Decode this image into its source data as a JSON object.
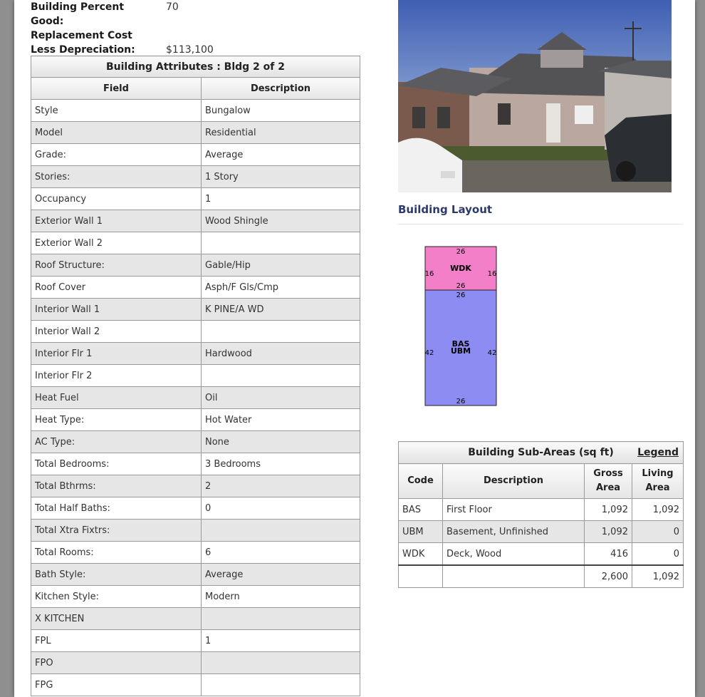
{
  "summary": {
    "rows": [
      {
        "label": "Building Percent",
        "value": "70"
      },
      {
        "label": "Good:",
        "value": ""
      },
      {
        "label": "Replacement Cost",
        "value": ""
      },
      {
        "label": "Less Depreciation:",
        "value": "$113,100"
      }
    ]
  },
  "attributes": {
    "caption": "Building Attributes : Bldg 2 of 2",
    "headers": {
      "field": "Field",
      "description": "Description"
    },
    "rows": [
      {
        "field": "Style",
        "description": "Bungalow"
      },
      {
        "field": "Model",
        "description": "Residential"
      },
      {
        "field": "Grade:",
        "description": "Average"
      },
      {
        "field": "Stories:",
        "description": "1 Story"
      },
      {
        "field": "Occupancy",
        "description": "1"
      },
      {
        "field": "Exterior Wall 1",
        "description": "Wood Shingle"
      },
      {
        "field": "Exterior Wall 2",
        "description": ""
      },
      {
        "field": "Roof Structure:",
        "description": "Gable/Hip"
      },
      {
        "field": "Roof Cover",
        "description": "Asph/F Gls/Cmp"
      },
      {
        "field": "Interior Wall 1",
        "description": "K PINE/A WD"
      },
      {
        "field": "Interior Wall 2",
        "description": ""
      },
      {
        "field": "Interior Flr 1",
        "description": "Hardwood"
      },
      {
        "field": "Interior Flr 2",
        "description": ""
      },
      {
        "field": "Heat Fuel",
        "description": "Oil"
      },
      {
        "field": "Heat Type:",
        "description": "Hot Water"
      },
      {
        "field": "AC Type:",
        "description": "None"
      },
      {
        "field": "Total Bedrooms:",
        "description": "3 Bedrooms"
      },
      {
        "field": "Total Bthrms:",
        "description": "2"
      },
      {
        "field": "Total Half Baths:",
        "description": "0"
      },
      {
        "field": "Total Xtra Fixtrs:",
        "description": ""
      },
      {
        "field": "Total Rooms:",
        "description": "6"
      },
      {
        "field": "Bath Style:",
        "description": "Average"
      },
      {
        "field": "Kitchen Style:",
        "description": "Modern"
      },
      {
        "field": "X KITCHEN",
        "description": ""
      },
      {
        "field": "FPL",
        "description": "1"
      },
      {
        "field": "FPO",
        "description": ""
      },
      {
        "field": "FPG",
        "description": ""
      }
    ]
  },
  "layout": {
    "title": "Building Layout",
    "sketch": {
      "top_section": {
        "label": "WDK",
        "top": "26",
        "bottom": "26",
        "left": "16",
        "right": "16",
        "color": "#f27fc8"
      },
      "bottom_section": {
        "label1": "BAS",
        "label2": "UBM",
        "top": "26",
        "bottom": "26",
        "left": "42",
        "right": "42",
        "color": "#8c8cf2"
      }
    }
  },
  "subareas": {
    "caption": "Building Sub-Areas (sq ft)",
    "legend": "Legend",
    "headers": {
      "code": "Code",
      "description": "Description",
      "gross1": "Gross",
      "gross2": "Area",
      "living1": "Living",
      "living2": "Area"
    },
    "rows": [
      {
        "code": "BAS",
        "description": "First Floor",
        "gross": "1,092",
        "living": "1,092"
      },
      {
        "code": "UBM",
        "description": "Basement, Unfinished",
        "gross": "1,092",
        "living": "0"
      },
      {
        "code": "WDK",
        "description": "Deck, Wood",
        "gross": "416",
        "living": "0"
      }
    ],
    "totals": {
      "gross": "2,600",
      "living": "1,092"
    }
  }
}
